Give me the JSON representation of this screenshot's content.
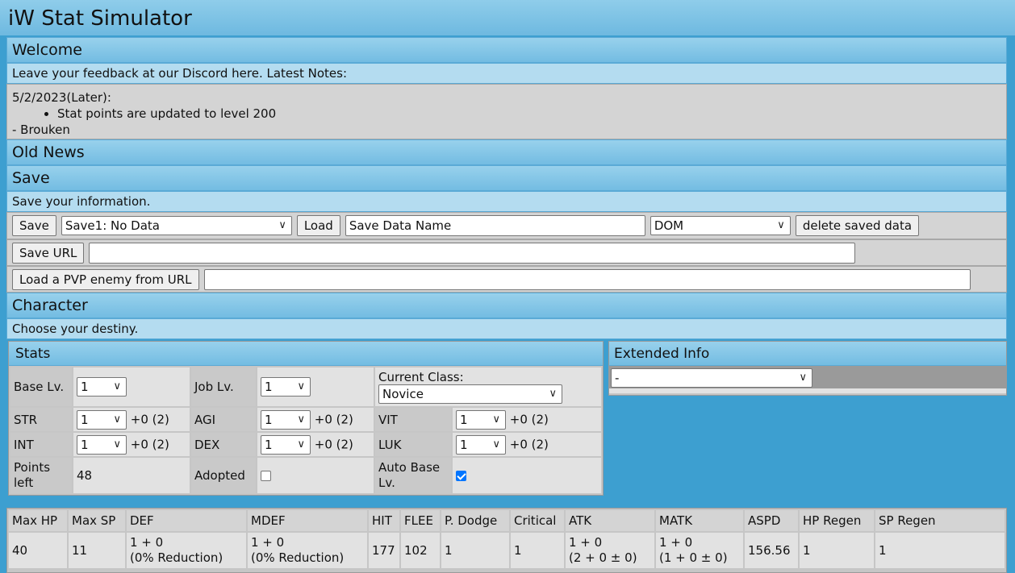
{
  "app": {
    "title": "iW Stat Simulator"
  },
  "welcome": {
    "header": "Welcome",
    "note": "Leave your feedback at our Discord here. Latest Notes:",
    "date": "5/2/2023(Later):",
    "bullet": "Stat points are updated to level 200",
    "signature": "- Brouken"
  },
  "old_news": {
    "header": "Old News"
  },
  "save": {
    "header": "Save",
    "note": "Save your information.",
    "save_label": "Save",
    "slot_value": "Save1: No Data",
    "load_label": "Load",
    "name_value": "Save Data Name",
    "mode_value": "DOM",
    "delete_label": "delete saved data",
    "save_url_label": "Save URL",
    "save_url_value": "",
    "pvp_label": "Load a PVP enemy from URL",
    "pvp_value": ""
  },
  "character": {
    "header": "Character",
    "note": "Choose your destiny."
  },
  "stats": {
    "header": "Stats",
    "base_lv_label": "Base Lv.",
    "base_lv_value": "1",
    "job_lv_label": "Job Lv.",
    "job_lv_value": "1",
    "class_label": "Current Class:",
    "class_value": "Novice",
    "str_label": "STR",
    "str_value": "1",
    "str_bonus": "+0 (2)",
    "agi_label": "AGI",
    "agi_value": "1",
    "agi_bonus": "+0 (2)",
    "vit_label": "VIT",
    "vit_value": "1",
    "vit_bonus": "+0 (2)",
    "int_label": "INT",
    "int_value": "1",
    "int_bonus": "+0 (2)",
    "dex_label": "DEX",
    "dex_value": "1",
    "dex_bonus": "+0 (2)",
    "luk_label": "LUK",
    "luk_value": "1",
    "luk_bonus": "+0 (2)",
    "points_label": "Points left",
    "points_value": "48",
    "adopted_label": "Adopted",
    "adopted_checked": false,
    "auto_label": "Auto Base Lv.",
    "auto_checked": true
  },
  "extended": {
    "header": "Extended Info",
    "select_value": "-"
  },
  "summary": {
    "headers": [
      "Max HP",
      "Max SP",
      "DEF",
      "MDEF",
      "HIT",
      "FLEE",
      "P. Dodge",
      "Critical",
      "ATK",
      "MATK",
      "ASPD",
      "HP Regen",
      "SP Regen"
    ],
    "max_hp": "40",
    "max_sp": "11",
    "def_line1": "1 + 0",
    "def_line2": "(0% Reduction)",
    "mdef_line1": "1 + 0",
    "mdef_line2": "(0% Reduction)",
    "hit": "177",
    "flee": "102",
    "p_dodge": "1",
    "critical": "1",
    "atk_line1": "1 + 0",
    "atk_line2": "(2 + 0 ± 0)",
    "matk_line1": "1 + 0",
    "matk_line2": "(1 + 0 ± 0)",
    "aspd": "156.56",
    "hp_regen": "1",
    "sp_regen": "1"
  },
  "icons": {
    "dropdown": "chevron-down-icon",
    "check": "checkmark-icon"
  }
}
